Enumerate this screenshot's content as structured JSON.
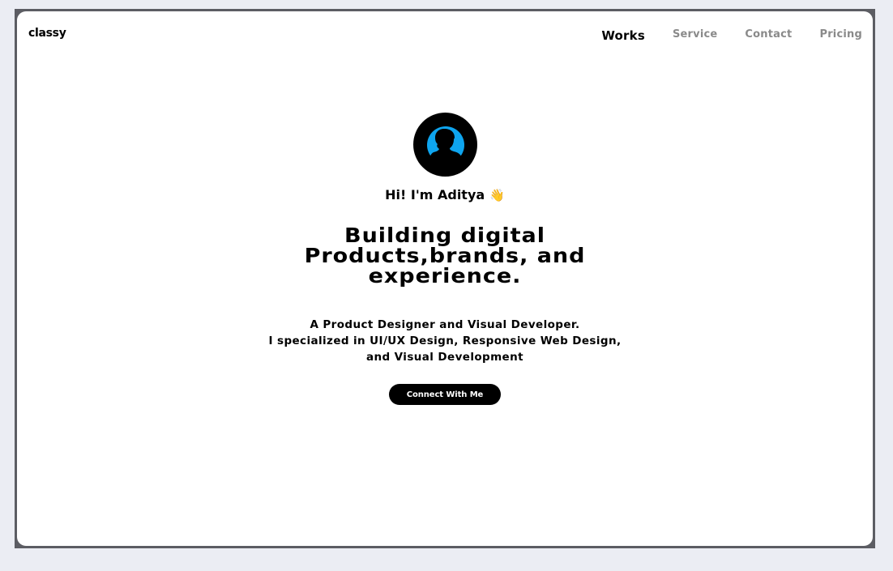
{
  "header": {
    "brand": "classy",
    "nav": [
      {
        "label": "Works",
        "active": true
      },
      {
        "label": "Service",
        "active": false
      },
      {
        "label": "Contact",
        "active": false
      },
      {
        "label": "Pricing",
        "active": false
      }
    ]
  },
  "hero": {
    "avatar_icon": "person-silhouette-icon",
    "avatar_accent": "#0ea5ef",
    "greeting": "Hi! I'm Aditya",
    "greeting_emoji": "👋",
    "headline_lines": [
      "Building digital",
      "Products,brands, and",
      "experience."
    ],
    "description_lines": [
      "A Product Designer and Visual Developer.",
      "I specialized in UI/UX Design, Responsive Web Design,",
      "and Visual Development"
    ],
    "cta_label": "Connect With Me"
  }
}
